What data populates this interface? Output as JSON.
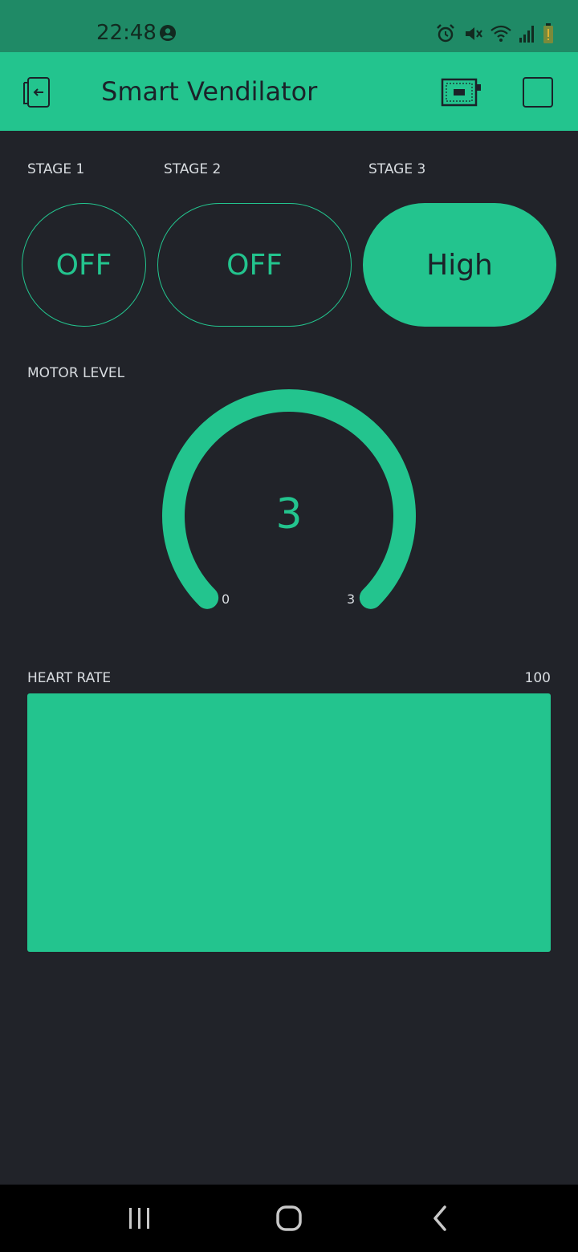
{
  "status_bar": {
    "time": "22:48",
    "icons": [
      "account-circle-icon",
      "alarm-icon",
      "mute-icon",
      "wifi-icon",
      "signal-icon",
      "battery-low-icon"
    ]
  },
  "header": {
    "title": "Smart Vendilator",
    "back_icon": "exit-icon",
    "device_icon": "device-icon",
    "stop_icon": "stop-icon"
  },
  "stages": [
    {
      "label": "STAGE 1",
      "value": "OFF",
      "state": "off"
    },
    {
      "label": "STAGE 2",
      "value": "OFF",
      "state": "off"
    },
    {
      "label": "STAGE 3",
      "value": "High",
      "state": "on"
    }
  ],
  "motor_level": {
    "label": "MOTOR LEVEL",
    "value": "3",
    "min": "0",
    "max": "3",
    "fill_fraction": 1.0
  },
  "heart_rate": {
    "label": "HEART RATE",
    "max": "100"
  },
  "colors": {
    "accent": "#23c48e",
    "background": "#212329",
    "status_bar": "#1f8a66",
    "nav_bar": "#000000"
  },
  "nav": {
    "recents_icon": "recents-icon",
    "home_icon": "home-icon",
    "back_icon": "back-icon"
  }
}
